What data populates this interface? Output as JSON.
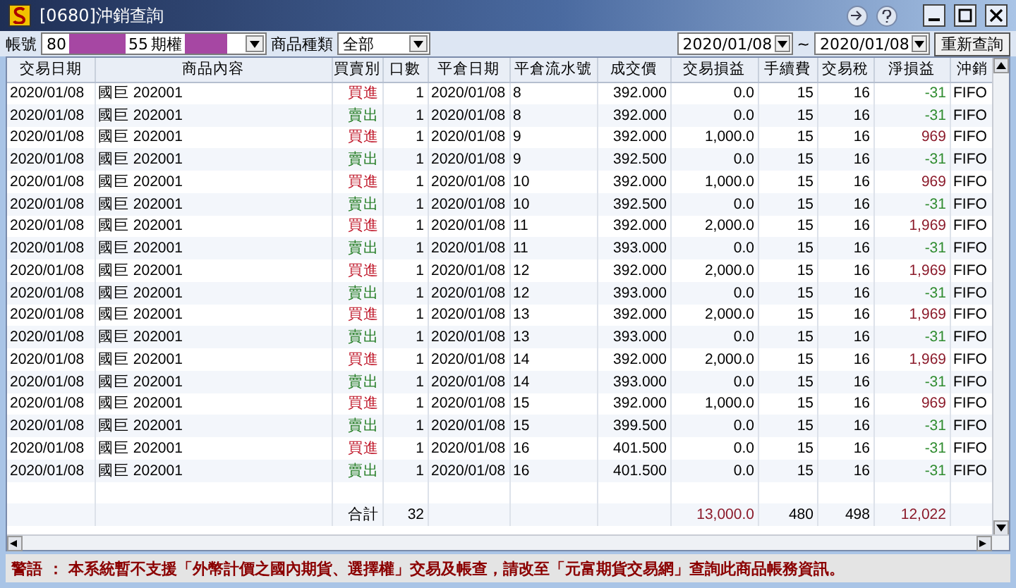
{
  "window": {
    "title": "[0680]沖銷查詢"
  },
  "toolbar": {
    "account_label": "帳號",
    "account_prefix": "80",
    "account_suffix": "55",
    "market": "期權",
    "product_type_label": "商品種類",
    "product_type": "全部",
    "date_from": "2020/01/08",
    "range_sep": "~",
    "date_to": "2020/01/08",
    "requery_button": "重新查詢"
  },
  "table": {
    "columns": [
      "交易日期",
      "商品內容",
      "買賣別",
      "口數",
      "平倉日期",
      "平倉流水號",
      "成交價",
      "交易損益",
      "手續費",
      "交易稅",
      "淨損益",
      "沖銷"
    ],
    "rows": [
      {
        "date": "2020/01/08",
        "product": "國巨  202001",
        "side": "買進",
        "kind": "buy",
        "qty": "1",
        "close_date": "2020/01/08",
        "serial": "8",
        "price": "392.000",
        "pl": "0.0",
        "fee": "15",
        "tax": "16",
        "net": "-31",
        "color": "#2e8b2e",
        "method": "FIFO"
      },
      {
        "date": "2020/01/08",
        "product": "國巨  202001",
        "side": "賣出",
        "kind": "sell",
        "qty": "1",
        "close_date": "2020/01/08",
        "serial": "8",
        "price": "392.000",
        "pl": "0.0",
        "fee": "15",
        "tax": "16",
        "net": "-31",
        "color": "#2e8b2e",
        "method": "FIFO"
      },
      {
        "date": "2020/01/08",
        "product": "國巨  202001",
        "side": "買進",
        "kind": "buy",
        "qty": "1",
        "close_date": "2020/01/08",
        "serial": "9",
        "price": "392.000",
        "pl": "1,000.0",
        "fee": "15",
        "tax": "16",
        "net": "969",
        "color": "#8b1a2a",
        "method": "FIFO"
      },
      {
        "date": "2020/01/08",
        "product": "國巨  202001",
        "side": "賣出",
        "kind": "sell",
        "qty": "1",
        "close_date": "2020/01/08",
        "serial": "9",
        "price": "392.500",
        "pl": "0.0",
        "fee": "15",
        "tax": "16",
        "net": "-31",
        "color": "#2e8b2e",
        "method": "FIFO"
      },
      {
        "date": "2020/01/08",
        "product": "國巨  202001",
        "side": "買進",
        "kind": "buy",
        "qty": "1",
        "close_date": "2020/01/08",
        "serial": "10",
        "price": "392.000",
        "pl": "1,000.0",
        "fee": "15",
        "tax": "16",
        "net": "969",
        "color": "#8b1a2a",
        "method": "FIFO"
      },
      {
        "date": "2020/01/08",
        "product": "國巨  202001",
        "side": "賣出",
        "kind": "sell",
        "qty": "1",
        "close_date": "2020/01/08",
        "serial": "10",
        "price": "392.500",
        "pl": "0.0",
        "fee": "15",
        "tax": "16",
        "net": "-31",
        "color": "#2e8b2e",
        "method": "FIFO"
      },
      {
        "date": "2020/01/08",
        "product": "國巨  202001",
        "side": "買進",
        "kind": "buy",
        "qty": "1",
        "close_date": "2020/01/08",
        "serial": "11",
        "price": "392.000",
        "pl": "2,000.0",
        "fee": "15",
        "tax": "16",
        "net": "1,969",
        "color": "#8b1a2a",
        "method": "FIFO"
      },
      {
        "date": "2020/01/08",
        "product": "國巨  202001",
        "side": "賣出",
        "kind": "sell",
        "qty": "1",
        "close_date": "2020/01/08",
        "serial": "11",
        "price": "393.000",
        "pl": "0.0",
        "fee": "15",
        "tax": "16",
        "net": "-31",
        "color": "#2e8b2e",
        "method": "FIFO"
      },
      {
        "date": "2020/01/08",
        "product": "國巨  202001",
        "side": "買進",
        "kind": "buy",
        "qty": "1",
        "close_date": "2020/01/08",
        "serial": "12",
        "price": "392.000",
        "pl": "2,000.0",
        "fee": "15",
        "tax": "16",
        "net": "1,969",
        "color": "#8b1a2a",
        "method": "FIFO"
      },
      {
        "date": "2020/01/08",
        "product": "國巨  202001",
        "side": "賣出",
        "kind": "sell",
        "qty": "1",
        "close_date": "2020/01/08",
        "serial": "12",
        "price": "393.000",
        "pl": "0.0",
        "fee": "15",
        "tax": "16",
        "net": "-31",
        "color": "#2e8b2e",
        "method": "FIFO"
      },
      {
        "date": "2020/01/08",
        "product": "國巨  202001",
        "side": "買進",
        "kind": "buy",
        "qty": "1",
        "close_date": "2020/01/08",
        "serial": "13",
        "price": "392.000",
        "pl": "2,000.0",
        "fee": "15",
        "tax": "16",
        "net": "1,969",
        "color": "#8b1a2a",
        "method": "FIFO"
      },
      {
        "date": "2020/01/08",
        "product": "國巨  202001",
        "side": "賣出",
        "kind": "sell",
        "qty": "1",
        "close_date": "2020/01/08",
        "serial": "13",
        "price": "393.000",
        "pl": "0.0",
        "fee": "15",
        "tax": "16",
        "net": "-31",
        "color": "#2e8b2e",
        "method": "FIFO"
      },
      {
        "date": "2020/01/08",
        "product": "國巨  202001",
        "side": "買進",
        "kind": "buy",
        "qty": "1",
        "close_date": "2020/01/08",
        "serial": "14",
        "price": "392.000",
        "pl": "2,000.0",
        "fee": "15",
        "tax": "16",
        "net": "1,969",
        "color": "#8b1a2a",
        "method": "FIFO"
      },
      {
        "date": "2020/01/08",
        "product": "國巨  202001",
        "side": "賣出",
        "kind": "sell",
        "qty": "1",
        "close_date": "2020/01/08",
        "serial": "14",
        "price": "393.000",
        "pl": "0.0",
        "fee": "15",
        "tax": "16",
        "net": "-31",
        "color": "#2e8b2e",
        "method": "FIFO"
      },
      {
        "date": "2020/01/08",
        "product": "國巨  202001",
        "side": "買進",
        "kind": "buy",
        "qty": "1",
        "close_date": "2020/01/08",
        "serial": "15",
        "price": "392.000",
        "pl": "1,000.0",
        "fee": "15",
        "tax": "16",
        "net": "969",
        "color": "#8b1a2a",
        "method": "FIFO"
      },
      {
        "date": "2020/01/08",
        "product": "國巨  202001",
        "side": "賣出",
        "kind": "sell",
        "qty": "1",
        "close_date": "2020/01/08",
        "serial": "15",
        "price": "399.500",
        "pl": "0.0",
        "fee": "15",
        "tax": "16",
        "net": "-31",
        "color": "#2e8b2e",
        "method": "FIFO"
      },
      {
        "date": "2020/01/08",
        "product": "國巨  202001",
        "side": "買進",
        "kind": "buy",
        "qty": "1",
        "close_date": "2020/01/08",
        "serial": "16",
        "price": "401.500",
        "pl": "0.0",
        "fee": "15",
        "tax": "16",
        "net": "-31",
        "color": "#2e8b2e",
        "method": "FIFO"
      },
      {
        "date": "2020/01/08",
        "product": "國巨  202001",
        "side": "賣出",
        "kind": "sell",
        "qty": "1",
        "close_date": "2020/01/08",
        "serial": "16",
        "price": "401.500",
        "pl": "0.0",
        "fee": "15",
        "tax": "16",
        "net": "-31",
        "color": "#2e8b2e",
        "method": "FIFO"
      }
    ],
    "total": {
      "label": "合計",
      "qty": "32",
      "pl": "13,000.0",
      "fee": "480",
      "tax": "498",
      "net": "12,022"
    }
  },
  "warning": "警語 ： 本系統暫不支援「外幣計價之國內期貨、選擇權」交易及帳查，請改至「元富期貨交易網」查詢此商品帳務資訊。"
}
